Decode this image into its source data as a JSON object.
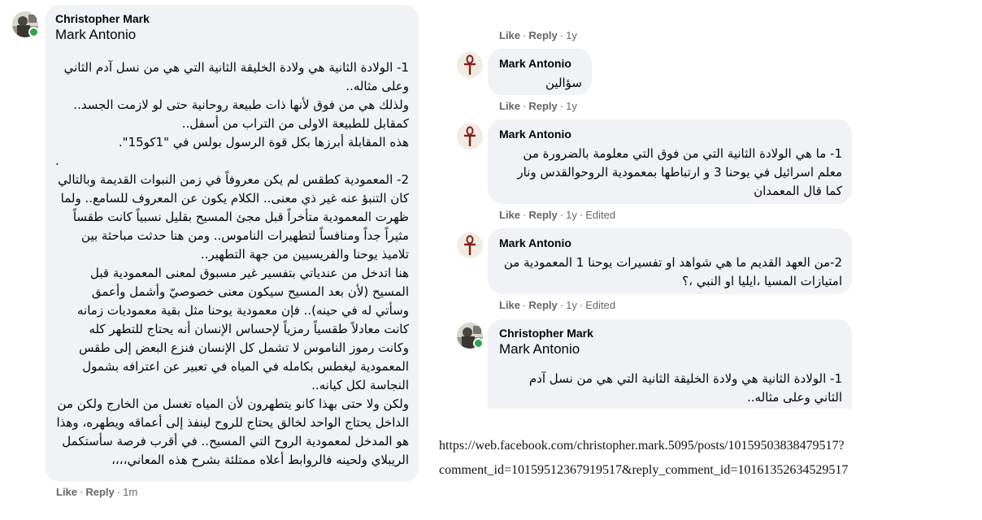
{
  "left_comment": {
    "author": "Christopher Mark",
    "mention": "Mark Antonio",
    "paragraphs": [
      "1- الولادة الثانية هي ولادة الخليقة الثانية التي هي من نسل آدم الثاني وعلى مثاله..",
      "ولذلك هي من فوق لأنها ذات طبيعة روحانية حتى لو لازمت الجسد..",
      "كمقابل للطبيعة الاولى من التراب من أسفل..",
      "هذه المقابلة أبرزها بكل قوة الرسول بولس في \"1كو15\".",
      ".",
      "2- المعمودية كطقس لم يكن معروفاً في زمن النبوات القديمة وبالتالي كان التنبؤ عنه غير ذي معنى.. الكلام يكون عن المعروف للسامع.. ولما ظهرت المعمودية متأخراً قبل مجئ المسيح بقليل نسبياً كانت طقساً مثيراً جداً ومنافساً لتطهيرات الناموس.. ومن هنا حدثت مباحثة بين تلاميذ يوحنا والفريسيين من جهة التطهير..",
      "هنا اتدخل من عندياتي بتفسير غير مسبوق لمعنى المعمودية قبل المسيح (لأن بعد المسيح سيكون معنى خصوصيّ وأشمل وأعمق وسأتي له في حينه).. فإن معمودية يوحنا مثل بقية معموديات زمانه كانت معادلاً طقسياً رمزياً لإحساس الإنسان أنه يحتاج للتطهر كله وكانت رموز الناموس لا تشمل كل الإنسان فنزع البعض إلى طقس المعمودية ليغطس بكامله في المياه في تعبير عن اعترافه بشمول النجاسة لكل كيانه..",
      "ولكن ولا حتى بهذا كانو يتطهرون لأن المياه تغسل من الخارج ولكن من الداخل يحتاج الواحد لخالق يحتاج للروح لينفذ إلى أعماقه ويطهره، وهذا هو المدخل لمعمودية الروح التي المسيح.. في أقرب فرصة سأستكمل الريبلاي ولحينه فالروابط أعلاه ممتلئة بشرح هذه المعاني،،،،"
    ],
    "like": "Like",
    "reply": "Reply",
    "time": "1m"
  },
  "top_meta": {
    "like": "Like",
    "reply": "Reply",
    "time": "1y"
  },
  "replies": [
    {
      "author": "Mark Antonio",
      "text": "سؤالين",
      "like": "Like",
      "reply": "Reply",
      "time": "1y",
      "edited": ""
    },
    {
      "author": "Mark Antonio",
      "text": "1- ما هي الولادة الثانية التي من فوق التي معلومة بالضرورة من معلم اسرائيل في يوحنا 3 و ارتباطها بمعمودية الروحوالقدس ونار كما قال المعمدان",
      "like": "Like",
      "reply": "Reply",
      "time": "1y",
      "edited": "Edited"
    },
    {
      "author": "Mark Antonio",
      "text": "2-من العهد القديم ما هي شواهد او تفسيرات يوحنا 1 المعمودية من امتيازات المسيا ،ايليا او النبي ،؟",
      "like": "Like",
      "reply": "Reply",
      "time": "1y",
      "edited": "Edited"
    }
  ],
  "partial_comment": {
    "author": "Christopher Mark",
    "mention": "Mark Antonio",
    "text": "1- الولادة الثانية هي ولادة الخليقة الثانية التي هي من نسل آدم الثاني وعلى مثاله.."
  },
  "url_lines": [
    "https://web.facebook.com/christopher.mark.5095/posts/10159503838479517?",
    "comment_id=10159512367919517&reply_comment_id=10161352634529517"
  ],
  "icons": {
    "ankh": "ankh-icon",
    "photo": "profile-photo-icon"
  },
  "colors": {
    "bubble": "#f0f2f5",
    "meta": "#65676b",
    "online": "#31a24c",
    "ankh": "#8b1a1a"
  }
}
